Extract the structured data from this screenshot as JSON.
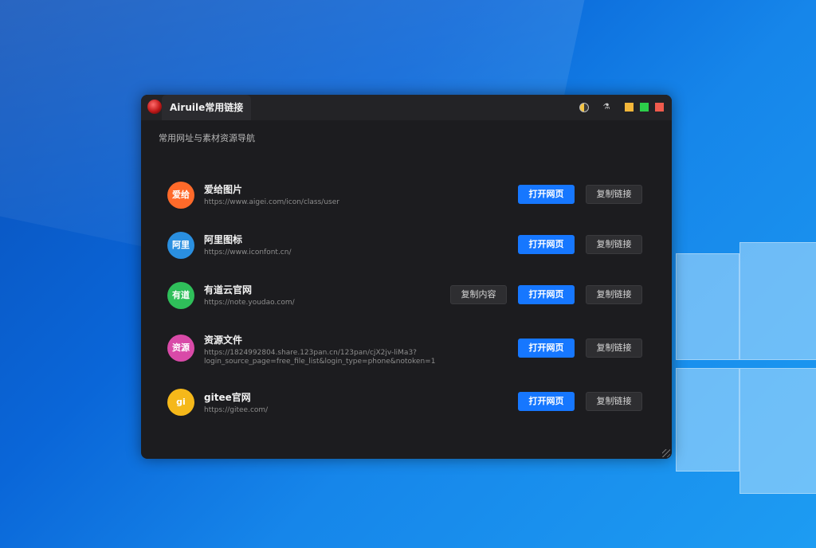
{
  "window": {
    "title": "Airuile常用链接",
    "subtitle": "常用网址与素材资源导航"
  },
  "items": [
    {
      "avatar": "爱给",
      "avatar_color": "#ff6a2a",
      "name": "爱给图片",
      "url": "https://www.aigei.com/icon/class/user",
      "open_label": "打开网页",
      "copy_link_label": "复制链接"
    },
    {
      "avatar": "阿里",
      "avatar_color": "#2a8fe0",
      "name": "阿里图标",
      "url": "https://www.iconfont.cn/",
      "open_label": "打开网页",
      "copy_link_label": "复制链接"
    },
    {
      "avatar": "有道",
      "avatar_color": "#2fbf5a",
      "name": "有道云官网",
      "url": "https://note.youdao.com/",
      "copy_content_label": "复制内容",
      "open_label": "打开网页",
      "copy_link_label": "复制链接"
    },
    {
      "avatar": "资源",
      "avatar_color": "#d94aa8",
      "name": "资源文件",
      "url_line1": "https://1824992804.share.123pan.cn/123pan/cjX2jv-liMa3?",
      "url_line2": "login_source_page=free_file_list&login_type=phone&notoken=1",
      "open_label": "打开网页",
      "copy_link_label": "复制链接"
    },
    {
      "avatar": "gi",
      "avatar_color": "#f5b81a",
      "name": "gitee官网",
      "url": "https://gitee.com/",
      "open_label": "打开网页",
      "copy_link_label": "复制链接"
    }
  ]
}
